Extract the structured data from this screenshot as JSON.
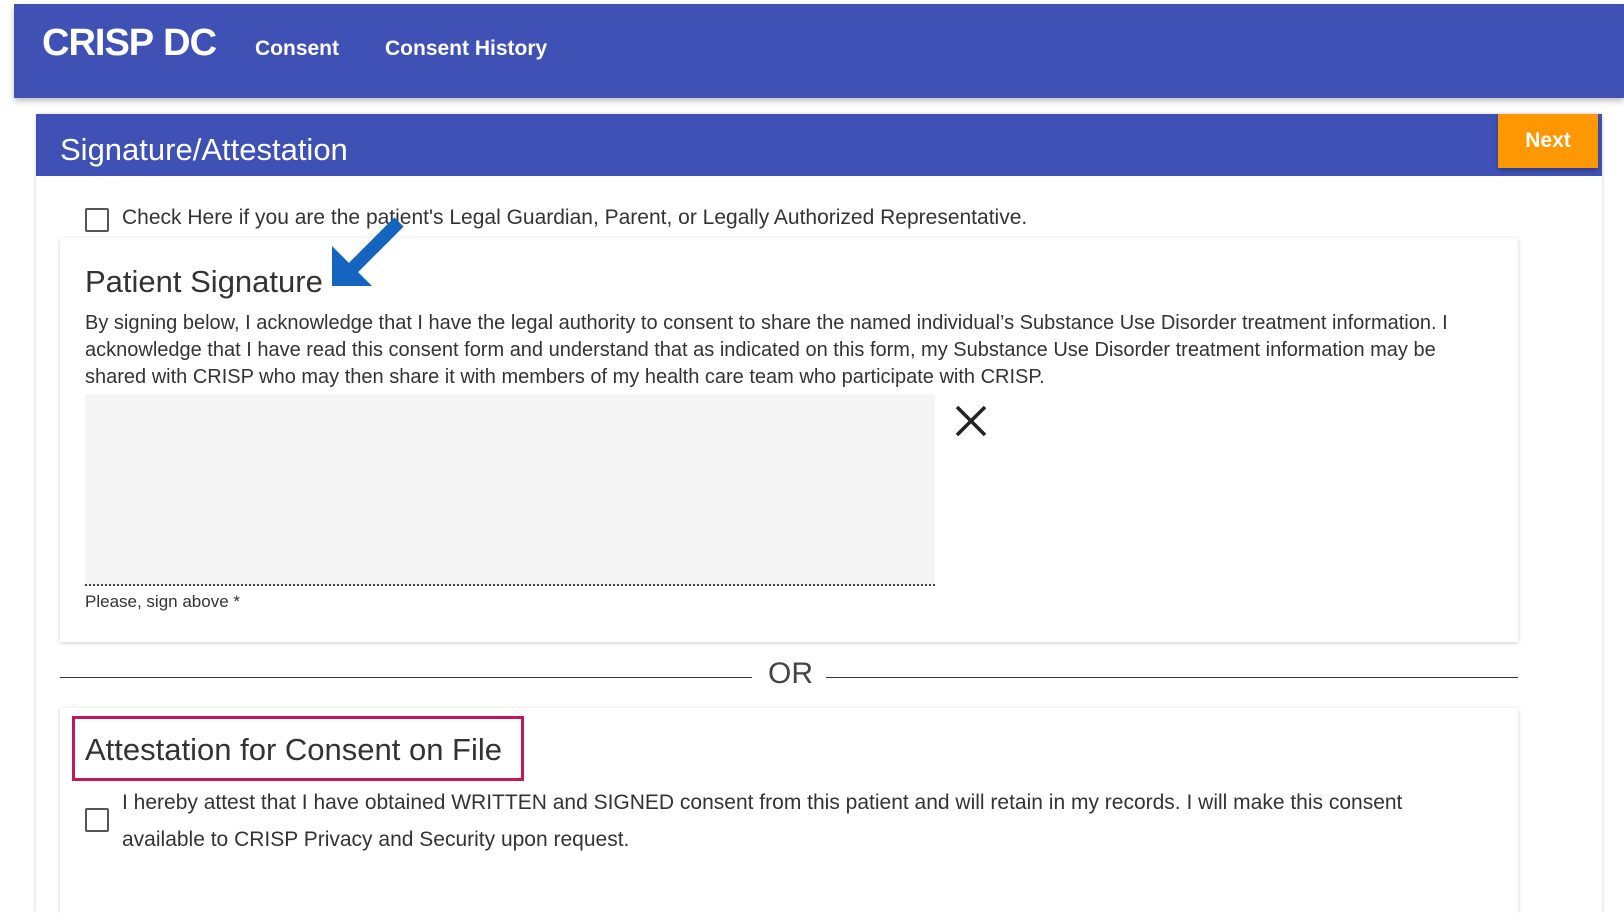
{
  "header": {
    "logo_crisp": "CRISP",
    "logo_dc": "DC",
    "nav": [
      "Consent",
      "Consent History"
    ],
    "bg_color": "#3f51b5"
  },
  "panel": {
    "title": "Signature/Attestation",
    "next_label": "Next",
    "next_color": "#ff9800"
  },
  "guardian": {
    "label": "Check Here if you are the patient's Legal Guardian, Parent, or Legally Authorized Representative.",
    "checked": false
  },
  "patient_signature": {
    "title": "Patient Signature",
    "text": "By signing below, I acknowledge that I have the legal authority to consent to share the named individual’s Substance Use Disorder treatment information. I acknowledge that I have read this consent form and understand that as indicated on this form, my Substance Use Disorder treatment information may be shared with CRISP who may then share it with members of my health care team who participate with CRISP.",
    "hint": "Please, sign above *",
    "clear_icon": "close-icon",
    "annotation_icon": "arrow-down-left-icon",
    "annotation_color": "#1565c0"
  },
  "divider": {
    "label": "OR"
  },
  "attestation": {
    "title": "Attestation for Consent on File",
    "text": "I hereby attest that I have obtained WRITTEN and SIGNED consent from this patient and will retain in my records. I will make this consent available to CRISP Privacy and Security upon request.",
    "checked": false,
    "highlight_color": "#c2185b"
  }
}
